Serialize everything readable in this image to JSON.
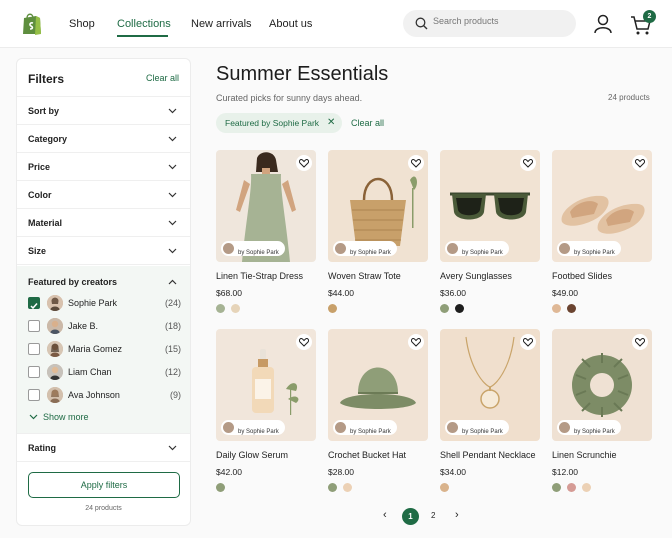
{
  "header": {
    "nav": [
      "Shop",
      "Collections",
      "New arrivals",
      "About us"
    ],
    "search_placeholder": "Search products",
    "cart_count": "2"
  },
  "filters": {
    "title": "Filters",
    "clear_all": "Clear all",
    "sections": [
      "Sort by",
      "Category",
      "Price",
      "Color",
      "Material",
      "Size"
    ],
    "creators_title": "Featured by creators",
    "creators": [
      {
        "name": "Sophie Park",
        "count": "(24)",
        "checked": true
      },
      {
        "name": "Jake B.",
        "count": "(18)",
        "checked": false
      },
      {
        "name": "Maria Gomez",
        "count": "(15)",
        "checked": false
      },
      {
        "name": "Liam Chan",
        "count": "(12)",
        "checked": false
      },
      {
        "name": "Ava Johnson",
        "count": "(9)",
        "checked": false
      }
    ],
    "show_more": "Show more",
    "rating": "Rating",
    "apply": "Apply filters",
    "count": "24 products"
  },
  "main": {
    "title": "Summer Essentials",
    "subtitle": "Curated picks for sunny days ahead.",
    "count": "24 products",
    "chip": "Featured by Sophie Park",
    "chip_clear": "Clear all"
  },
  "products": [
    {
      "name": "Linen Tie-Strap Dress",
      "price": "$68.00",
      "by": "by Sophie Park",
      "swatches": [
        "#a6b394",
        "#e6d4b9"
      ]
    },
    {
      "name": "Woven Straw Tote",
      "price": "$44.00",
      "by": "by Sophie Park",
      "swatches": [
        "#c8a06a"
      ]
    },
    {
      "name": "Avery Sunglasses",
      "price": "$36.00",
      "by": "by Sophie Park",
      "swatches": [
        "#8f9e78",
        "#1e1e1e"
      ]
    },
    {
      "name": "Footbed Slides",
      "price": "$49.00",
      "by": "by Sophie Park",
      "swatches": [
        "#dfb896",
        "#6b4430"
      ]
    },
    {
      "name": "Daily Glow Serum",
      "price": "$42.00",
      "by": "by Sophie Park",
      "swatches": [
        "#8f9e78"
      ]
    },
    {
      "name": "Crochet Bucket Hat",
      "price": "$28.00",
      "by": "by Sophie Park",
      "swatches": [
        "#8f9e78",
        "#ecd1b5"
      ]
    },
    {
      "name": "Shell Pendant Necklace",
      "price": "$34.00",
      "by": "by Sophie Park",
      "swatches": [
        "#d9b38c"
      ]
    },
    {
      "name": "Linen Scrunchie",
      "price": "$12.00",
      "by": "by Sophie Park",
      "swatches": [
        "#8f9e78",
        "#d59b95",
        "#ecd1b5"
      ]
    }
  ],
  "pagination": {
    "pages": [
      "1",
      "2"
    ],
    "prev": "‹",
    "next": "›"
  },
  "colors": {
    "brand": "#1f6b45",
    "chip_bg": "#e8f1ea"
  }
}
